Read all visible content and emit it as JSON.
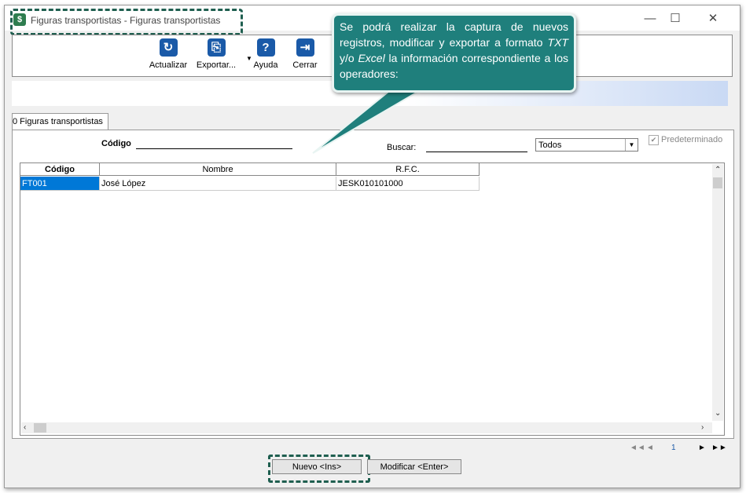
{
  "window": {
    "title": "Figuras transportistas - Figuras transportistas",
    "app_icon": "$",
    "controls": {
      "minimize": "—",
      "maximize": "☐",
      "close": "✕"
    }
  },
  "toolbar": {
    "buttons": [
      {
        "label": "Actualizar",
        "icon": "refresh-icon",
        "glyph": "↻"
      },
      {
        "label": "Exportar...",
        "icon": "export-icon",
        "glyph": "⎘"
      },
      {
        "label": "Ayuda",
        "icon": "help-icon",
        "glyph": "?"
      },
      {
        "label": "Cerrar",
        "icon": "exit-icon",
        "glyph": "⇥"
      }
    ],
    "dropdown_glyph": "▼"
  },
  "tab": {
    "label": "0 Figuras transportistas"
  },
  "filters": {
    "codigo_label": "Código",
    "codigo_value": "",
    "buscar_label": "Buscar:",
    "buscar_value": "",
    "select_value": "Todos",
    "checkbox_label": "Predeterminado",
    "checkbox_checked": true
  },
  "grid": {
    "columns": [
      "Código",
      "Nombre",
      "R.F.C."
    ],
    "rows": [
      [
        "FT001",
        "José López",
        "JESK010101000"
      ]
    ]
  },
  "pager": {
    "first": "◄◄",
    "prev": "◄",
    "page": "1",
    "next": "►",
    "last": "►►"
  },
  "buttons": {
    "nuevo": "Nuevo <Ins>",
    "modificar": "Modificar <Enter>"
  },
  "callout": {
    "part1": "Se podrá realizar la captura de nuevos registros, modificar y exportar a formato ",
    "txt": "TXT",
    "part2": " y/o ",
    "excel": "Excel",
    "part3": " la información correspondiente a los operadores:"
  },
  "colors": {
    "accent": "#1f7f7c",
    "selection": "#0078d7",
    "frame": "#1f5f50"
  }
}
